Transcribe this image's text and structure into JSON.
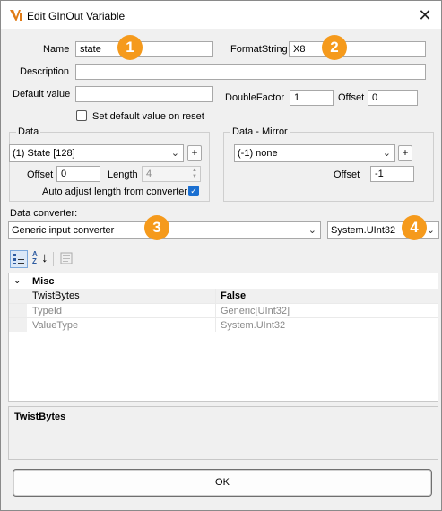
{
  "window": {
    "title": "Edit GInOut Variable",
    "close_glyph": "✕"
  },
  "fields": {
    "name_label": "Name",
    "name_value": "state",
    "format_label": "FormatString",
    "format_value": "X8",
    "description_label": "Description",
    "description_value": "",
    "default_label": "Default value",
    "default_value": "",
    "double_factor_label": "DoubleFactor",
    "double_factor_value": "1",
    "offset_label": "Offset",
    "offset_value": "0",
    "reset_checkbox_label": "Set default value on reset",
    "reset_checked": false
  },
  "data_group": {
    "title": "Data",
    "combo_value": "(1) State [128]",
    "plus_label": "+",
    "offset_label": "Offset",
    "offset_value": "0",
    "length_label": "Length",
    "length_value": "4",
    "auto_adjust_label": "Auto adjust length from converter",
    "auto_adjust_checked": true
  },
  "mirror_group": {
    "title": "Data - Mirror",
    "combo_value": "(-1) none",
    "plus_label": "+",
    "offset_label": "Offset",
    "offset_value": "-1"
  },
  "converter": {
    "label": "Data converter:",
    "combo_value": "Generic input converter",
    "type_value": "System.UInt32"
  },
  "badges": [
    "1",
    "2",
    "3",
    "4"
  ],
  "property_grid": {
    "sort_icon_text": "AZ",
    "category": "Misc",
    "rows": [
      {
        "name": "TwistBytes",
        "value": "False",
        "readonly": false
      },
      {
        "name": "TypeId",
        "value": "Generic[UInt32]",
        "readonly": true
      },
      {
        "name": "ValueType",
        "value": "System.UInt32",
        "readonly": true
      }
    ],
    "description_title": "TwistBytes"
  },
  "ok_button": {
    "label": "OK"
  },
  "colors": {
    "badge": "#f59a1c",
    "check_accent": "#1a6fd1",
    "app_icon": "#e07b16"
  },
  "icons": {
    "app": "app-logo-icon",
    "close": "close-icon",
    "categorized": "categorized-view-icon",
    "alphabetical": "alphabetical-sort-icon",
    "property_pages": "property-pages-icon",
    "chevron": "chevron-down-icon",
    "expand": "expand-chevron-icon"
  }
}
